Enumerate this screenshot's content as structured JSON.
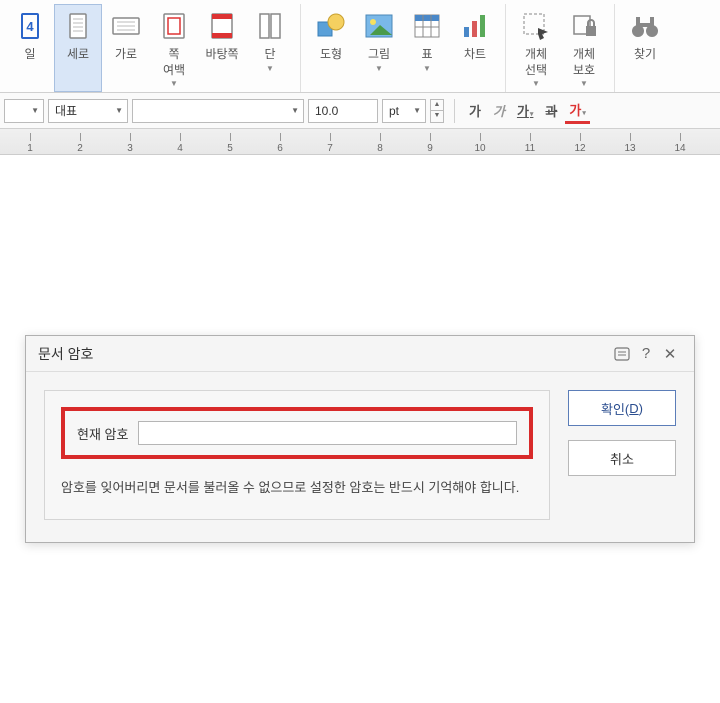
{
  "ribbon": {
    "file": "일",
    "portrait": "세로",
    "landscape": "가로",
    "page_margin": "쪽\n여백",
    "background": "바탕쪽",
    "columns": "단",
    "shape": "도형",
    "picture": "그림",
    "table": "표",
    "chart": "차트",
    "object_select": "개체\n선택",
    "object_protect": "개체\n보호",
    "find": "찾기"
  },
  "format": {
    "style": "",
    "para": "대표",
    "font": "",
    "size": "10.0",
    "size_unit": "pt",
    "bold": "가",
    "italic": "가",
    "underline": "가",
    "strike": "과",
    "fontcolor": "가"
  },
  "ruler": [
    "1",
    "2",
    "3",
    "4",
    "5",
    "6",
    "7",
    "8",
    "9",
    "10",
    "11",
    "12",
    "13",
    "14"
  ],
  "dialog": {
    "title": "문서 암호",
    "field_label": "현재 암호",
    "field_value": "",
    "hint": "암호를 잊어버리면 문서를 불러올 수 없으므로 설정한 암호는 반드시 기억해야 합니다.",
    "ok_prefix": "확인(",
    "ok_key": "D",
    "ok_suffix": ")",
    "cancel": "취소"
  }
}
